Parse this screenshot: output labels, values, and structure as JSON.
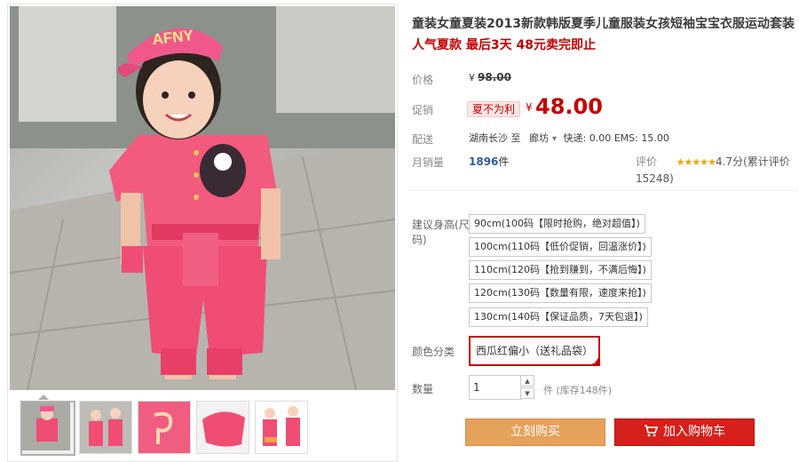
{
  "product": {
    "title": "童装女童夏装2013新款韩版夏季儿童服装女孩短袖宝宝衣服运动套装",
    "subtitle": "人气夏款 最后3天 48元卖完即止"
  },
  "price": {
    "label": "价格",
    "currency": "¥",
    "original": "98.00"
  },
  "promo": {
    "label": "促销",
    "badge": "夏不为利",
    "currency": "¥",
    "price": "48.00"
  },
  "shipping": {
    "label": "配送",
    "from": "湖南长沙",
    "to_word": "至",
    "to": "廊坊",
    "fees": "快递: 0.00 EMS: 15.00"
  },
  "sales": {
    "label": "月销量",
    "count": "1896",
    "unit": "件"
  },
  "rating": {
    "label": "评价",
    "stars": "★★★★★",
    "score": "4.7分",
    "count_text": "(累计评价15248)"
  },
  "height": {
    "label": "建议身高(尺码)",
    "options": [
      "90cm(100码【限时抢购，绝对超值】)",
      "100cm(110码【低价促销，回温涨价】)",
      "110cm(120码【抢到赚到，不满后悔】)",
      "120cm(130码【数量有限，速度来抢】)",
      "130cm(140码【保证品质，7天包退】)"
    ]
  },
  "color": {
    "label": "颜色分类",
    "selected": "西瓜红偏小（送礼品袋）",
    "check": "✓"
  },
  "quantity": {
    "label": "数量",
    "value": "1",
    "up": "▲",
    "down": "▼",
    "stock": "件 (库存148件)"
  },
  "actions": {
    "buy": "立刻购买",
    "cart": "加入购物车"
  },
  "photo": {
    "cap_text": "AFNY"
  },
  "colors": {
    "accent_red": "#c40000",
    "buy_orange": "#e6a15b",
    "cart_red": "#d5201b",
    "outfit_pink": "#ef4d74"
  }
}
